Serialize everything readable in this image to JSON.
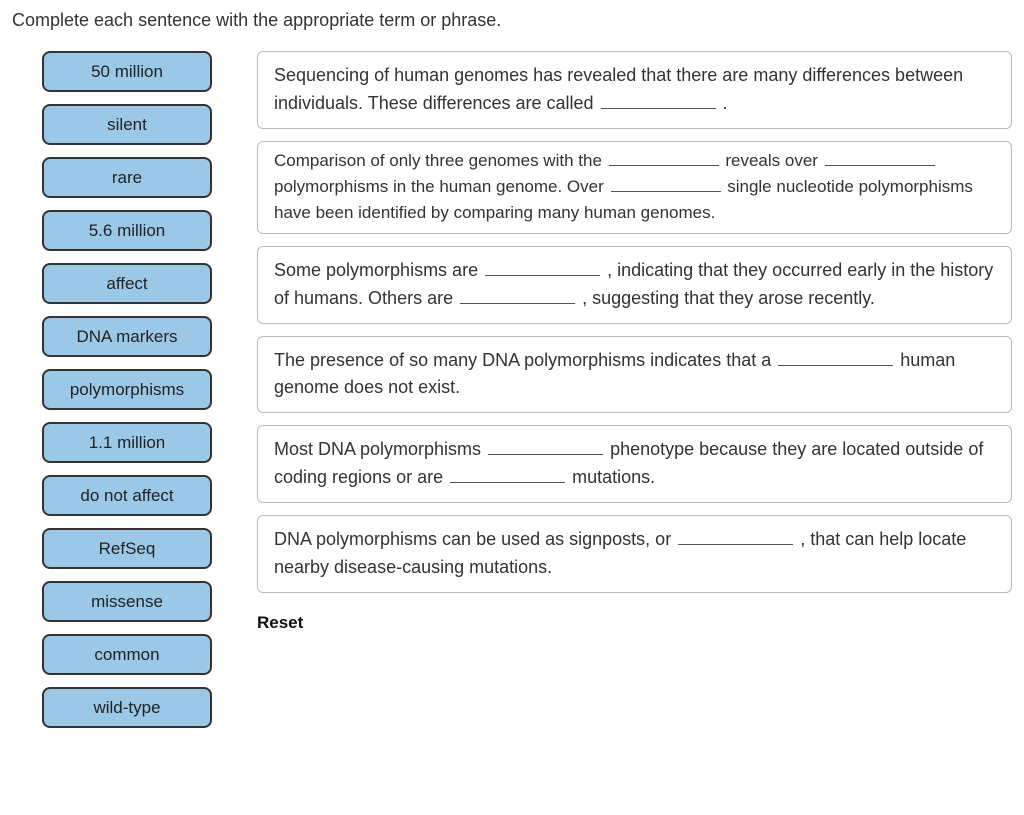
{
  "instruction": "Complete each sentence with the appropriate term or phrase.",
  "terms": [
    "50 million",
    "silent",
    "rare",
    "5.6 million",
    "affect",
    "DNA markers",
    "polymorphisms",
    "1.1 million",
    "do not affect",
    "RefSeq",
    "missense",
    "common",
    "wild-type"
  ],
  "sentences": {
    "s1a": "Sequencing of human genomes has revealed that there are many differences between individuals. These differences are called ",
    "s1b": " .",
    "s2a": "Comparison of only three genomes with the ",
    "s2b": " reveals over ",
    "s2c": " polymorphisms in the human genome. Over ",
    "s2d": " single nucleotide polymorphisms have been identified by comparing many human genomes.",
    "s3a": "Some polymorphisms are ",
    "s3b": " , indicating that they occurred early in the history of humans. Others are ",
    "s3c": " , suggesting that they arose recently.",
    "s4a": "The presence of so many DNA polymorphisms indicates that a ",
    "s4b": " human genome does not exist.",
    "s5a": "Most DNA polymorphisms ",
    "s5b": " phenotype because they are located outside of coding regions or are ",
    "s5c": " mutations.",
    "s6a": "DNA polymorphisms can be used as signposts, or ",
    "s6b": " , that can help locate nearby disease-causing mutations."
  },
  "reset_label": "Reset"
}
